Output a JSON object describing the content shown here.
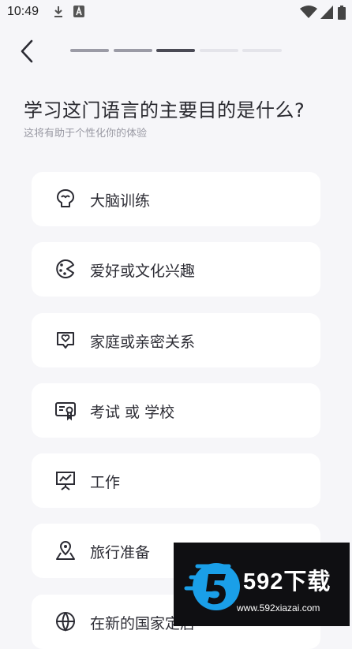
{
  "status_bar": {
    "time": "10:49"
  },
  "header": {
    "title": "学习这门语言的主要目的是什么?",
    "subtitle": "这将有助于个性化你的体验"
  },
  "progress": {
    "total_steps": 5,
    "current_step": 3
  },
  "options": [
    {
      "label": "大脑训练",
      "icon": "brain-icon"
    },
    {
      "label": "爱好或文化兴趣",
      "icon": "palette-icon"
    },
    {
      "label": "家庭或亲密关系",
      "icon": "heart-chat-icon"
    },
    {
      "label": "考试 或 学校",
      "icon": "certificate-icon"
    },
    {
      "label": "工作",
      "icon": "presentation-chart-icon"
    },
    {
      "label": "旅行准备",
      "icon": "map-pin-icon"
    },
    {
      "label": "在新的国家定居",
      "icon": "globe-icon"
    }
  ],
  "watermark": {
    "brand": "592下载",
    "url": "www.592xiazai.com"
  },
  "colors": {
    "background": "#f6f6f9",
    "progress_done": "#9b9ba6",
    "progress_current": "#4a4a55",
    "progress_todo": "#e4e4ea"
  }
}
